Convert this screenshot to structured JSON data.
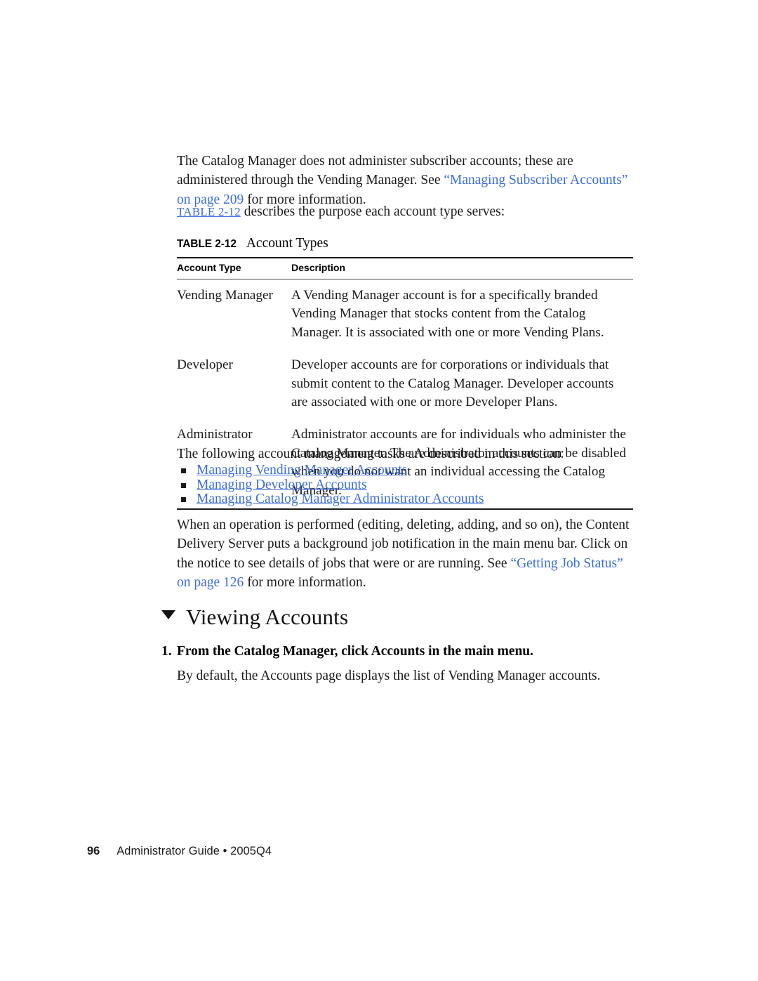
{
  "document": {
    "intro": {
      "text_before_link": "The Catalog Manager does not administer subscriber accounts; these are administered through the Vending Manager. See ",
      "link": "“Managing Subscriber Accounts” on page 209",
      "text_after_link": " for more information."
    },
    "table_intro": {
      "reference": "TABLE 2-12",
      "text": " describes the purpose each account type serves:"
    },
    "table": {
      "caption_label": "TABLE 2-12",
      "caption_title": "Account Types",
      "columns": [
        "Account Type",
        "Description"
      ],
      "rows": [
        {
          "type": "Vending Manager",
          "description": "A Vending Manager account is for a specifically branded Vending Manager that stocks content from the Catalog Manager. It is associated with one or more Vending Plans."
        },
        {
          "type": "Developer",
          "description": "Developer accounts are for corporations or individuals that submit content to the Catalog Manager. Developer accounts are associated with one or more Developer Plans."
        },
        {
          "type": "Administrator",
          "description": "Administrator accounts are for individuals who administer the Catalog Manager. The Administrator accounts can be disabled when you do not want an individual accessing the Catalog Manager."
        }
      ]
    },
    "tasks": {
      "intro": "The following account management tasks are described in this section:",
      "items": [
        "Managing Vending Manager Accounts",
        "Managing Developer Accounts",
        "Managing Catalog Manager Administrator Accounts"
      ]
    },
    "operation_note": {
      "text_before_link": "When an operation is performed (editing, deleting, adding, and so on), the Content Delivery Server puts a background job notification in the main menu bar. Click on the notice to see details of jobs that were or are running. See ",
      "link": "“Getting Job Status” on page 126",
      "text_after_link": " for more information."
    },
    "section": {
      "heading": "Viewing Accounts",
      "step_number": "1.",
      "step_title": "From the Catalog Manager, click Accounts in the main menu.",
      "step_body": "By default, the Accounts page displays the list of Vending Manager accounts."
    },
    "footer": {
      "page_number": "96",
      "text": "Administrator Guide • 2005Q4"
    },
    "colors": {
      "link": "#3c6ed8",
      "text": "#1a1a1a",
      "rule": "#1a1a1a"
    }
  }
}
